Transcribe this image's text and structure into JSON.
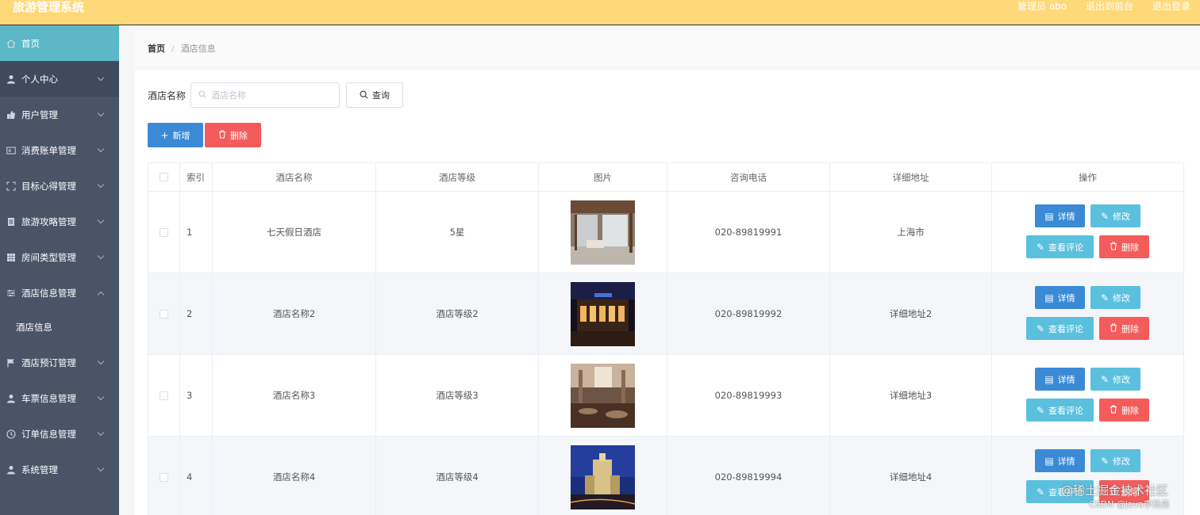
{
  "header": {
    "title": "旅游管理系统",
    "user": "管理员 abo",
    "to_front": "退出到前台",
    "logout": "退出登录",
    "bg_color": "#ffd879"
  },
  "sidebar": {
    "items": [
      {
        "label": "首页",
        "icon": "home-icon"
      },
      {
        "label": "个人中心",
        "icon": "user-icon"
      },
      {
        "label": "用户管理",
        "icon": "thumb-icon"
      },
      {
        "label": "消费账单管理",
        "icon": "card-icon"
      },
      {
        "label": "目标心得管理",
        "icon": "target-icon"
      },
      {
        "label": "旅游攻略管理",
        "icon": "doc-icon"
      },
      {
        "label": "房间类型管理",
        "icon": "grid-icon"
      },
      {
        "label": "酒店信息管理",
        "icon": "sliders-icon"
      },
      {
        "label": "酒店预订管理",
        "icon": "flag-icon"
      },
      {
        "label": "车票信息管理",
        "icon": "people-icon"
      },
      {
        "label": "订单信息管理",
        "icon": "clock-icon"
      },
      {
        "label": "系统管理",
        "icon": "person-icon"
      }
    ],
    "sub_item": "酒店信息",
    "bg_color": "#495466",
    "active_color": "#5cb7c7"
  },
  "breadcrumb": {
    "home": "首页",
    "separator": "/",
    "current": "酒店信息"
  },
  "search": {
    "label": "酒店名称",
    "placeholder": "酒店名称",
    "button": "查询"
  },
  "toolbar": {
    "add": "新增",
    "delete": "删除"
  },
  "table": {
    "headers": {
      "index": "索引",
      "name": "酒店名称",
      "level": "酒店等级",
      "image": "图片",
      "phone": "咨询电话",
      "address": "详细地址",
      "actions": "操作"
    },
    "rows": [
      {
        "index": "1",
        "name": "七天假日酒店",
        "level": "5星",
        "phone": "020-89819991",
        "address": "上海市",
        "image": "hotel-lobby-photo"
      },
      {
        "index": "2",
        "name": "酒店名称2",
        "level": "酒店等级2",
        "phone": "020-89819992",
        "address": "详细地址2",
        "image": "hotel-night-facade-photo"
      },
      {
        "index": "3",
        "name": "酒店名称3",
        "level": "酒店等级3",
        "phone": "020-89819993",
        "address": "详细地址3",
        "image": "hotel-restaurant-photo"
      },
      {
        "index": "4",
        "name": "酒店名称4",
        "level": "酒店等级4",
        "phone": "020-89819994",
        "address": "详细地址4",
        "image": "hotel-tower-night-photo"
      }
    ],
    "row_actions": {
      "detail": "详情",
      "edit": "修改",
      "review": "查看评论",
      "delete": "删除"
    }
  },
  "watermark": {
    "line1": "@稀土掘金技术社区",
    "line2": "CSDN @java李杨勇"
  },
  "colors": {
    "primary": "#3a8ad6",
    "info": "#5bc0de",
    "danger": "#f45c5c"
  }
}
